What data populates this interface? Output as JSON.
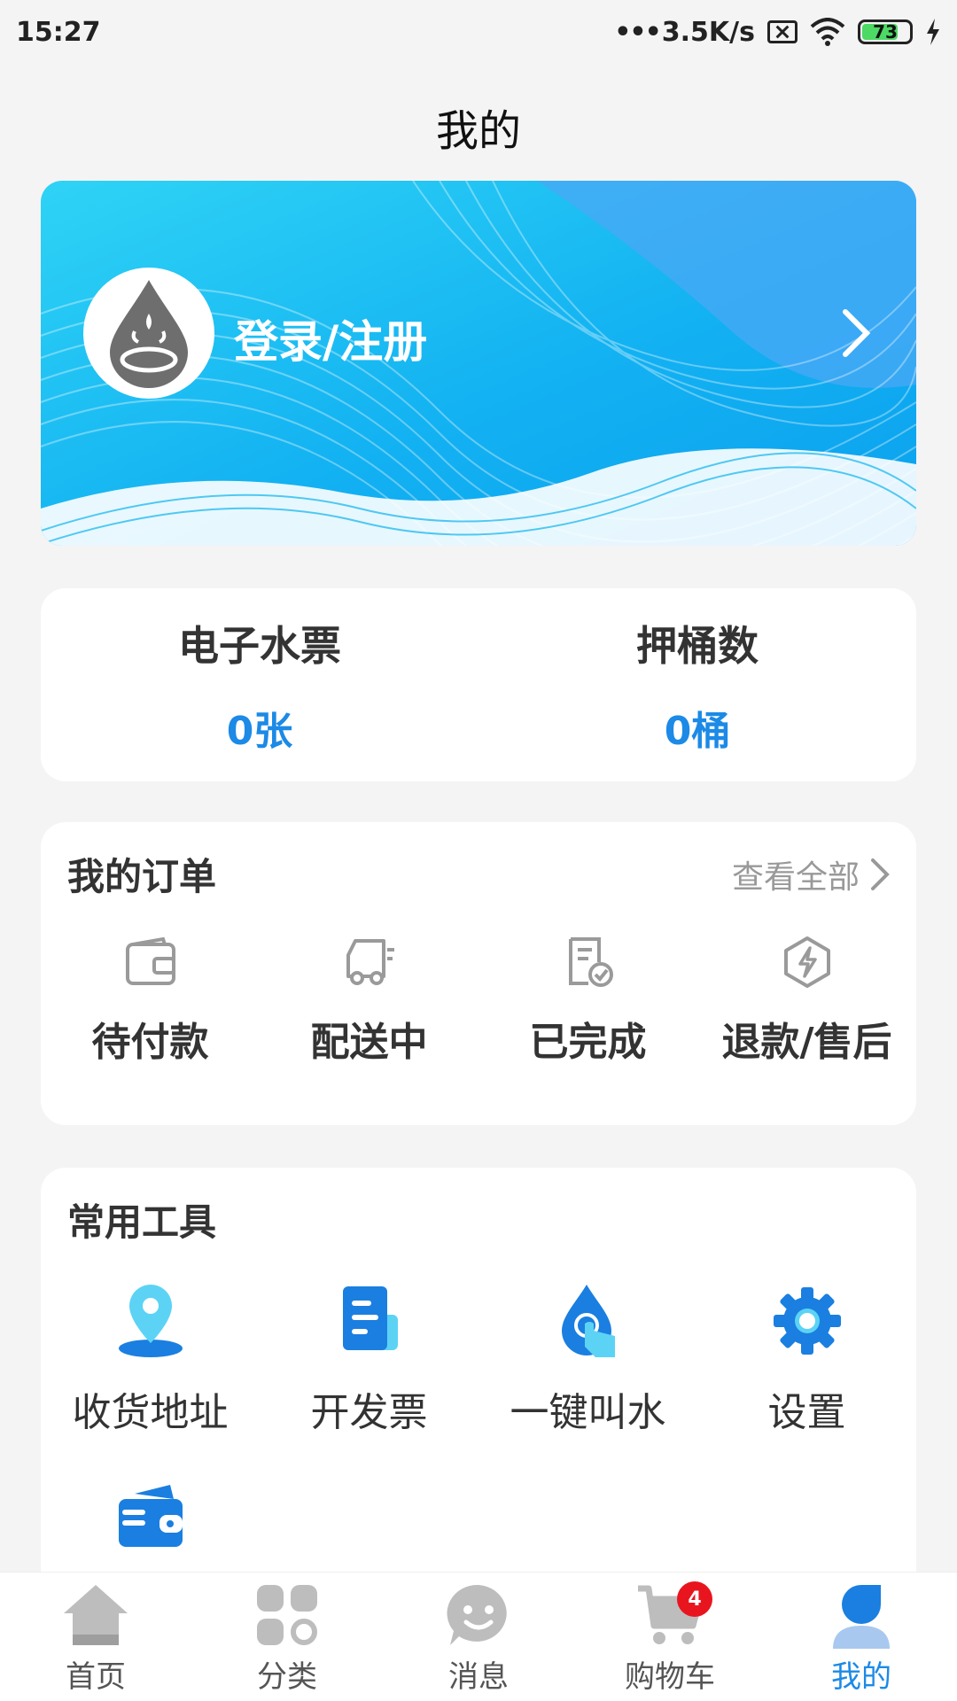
{
  "status_bar": {
    "time": "15:27",
    "network_speed": "3.5K/s",
    "battery": "73"
  },
  "header": {
    "title": "我的"
  },
  "banner": {
    "login_label": "登录/注册"
  },
  "stats": [
    {
      "label": "电子水票",
      "value": "0张"
    },
    {
      "label": "押桶数",
      "value": "0桶"
    }
  ],
  "orders": {
    "title": "我的订单",
    "view_all": "查看全部",
    "items": [
      {
        "label": "待付款",
        "icon": "wallet-icon"
      },
      {
        "label": "配送中",
        "icon": "delivery-truck-icon"
      },
      {
        "label": "已完成",
        "icon": "completed-document-icon"
      },
      {
        "label": "退款/售后",
        "icon": "refund-lightning-icon"
      }
    ]
  },
  "tools": {
    "title": "常用工具",
    "items": [
      {
        "label": "收货地址",
        "icon": "location-pin-icon"
      },
      {
        "label": "开发票",
        "icon": "invoice-icon"
      },
      {
        "label": "一键叫水",
        "icon": "water-drop-tap-icon"
      },
      {
        "label": "设置",
        "icon": "gear-icon"
      },
      {
        "label": "",
        "icon": "wallet-card-icon"
      }
    ]
  },
  "bottom_nav": {
    "items": [
      {
        "label": "首页",
        "icon": "home-icon"
      },
      {
        "label": "分类",
        "icon": "category-icon"
      },
      {
        "label": "消息",
        "icon": "message-icon"
      },
      {
        "label": "购物车",
        "icon": "cart-icon",
        "badge": "4"
      },
      {
        "label": "我的",
        "icon": "profile-icon",
        "active": true
      }
    ]
  },
  "colors": {
    "accent": "#1c8ae6",
    "banner_light": "#29d0f5",
    "banner_dark": "#0fa6f0",
    "badge": "#e8151f",
    "inactive_icon": "#bdbdbd"
  }
}
